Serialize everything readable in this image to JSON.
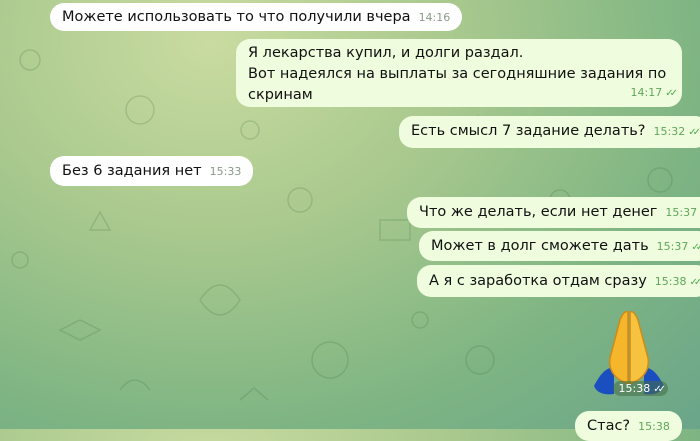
{
  "messages": [
    {
      "id": "m1",
      "dir": "in",
      "text": "Можете использовать то что получили вчера",
      "time": "14:16"
    },
    {
      "id": "m2",
      "dir": "out",
      "lines": [
        "Я лекарства купил, и долги раздал.",
        "Вот надеялся на выплаты за сегодняшние задания по",
        "скринам"
      ],
      "time": "14:17"
    },
    {
      "id": "m3",
      "dir": "out",
      "text": "Есть смысл 7 задание делать?",
      "time": "15:32"
    },
    {
      "id": "m4",
      "dir": "in",
      "text": "Без 6 задания нет",
      "time": "15:33"
    },
    {
      "id": "m5",
      "dir": "out",
      "text": "Что же делать, если нет денег",
      "time": "15:37"
    },
    {
      "id": "m6",
      "dir": "out",
      "text": "Может в долг сможете дать",
      "time": "15:37"
    },
    {
      "id": "m7",
      "dir": "out",
      "text": "А я с заработка отдам сразу",
      "time": "15:38"
    },
    {
      "id": "m8",
      "dir": "out",
      "type": "emoji",
      "emoji": "praying-hands",
      "time": "15:38"
    },
    {
      "id": "m9",
      "dir": "out",
      "text": "Стас?",
      "time": "15:38"
    }
  ],
  "colors": {
    "incoming": "#ffffff",
    "outgoing": "#effdde",
    "read_checks": "#4fae4e"
  }
}
